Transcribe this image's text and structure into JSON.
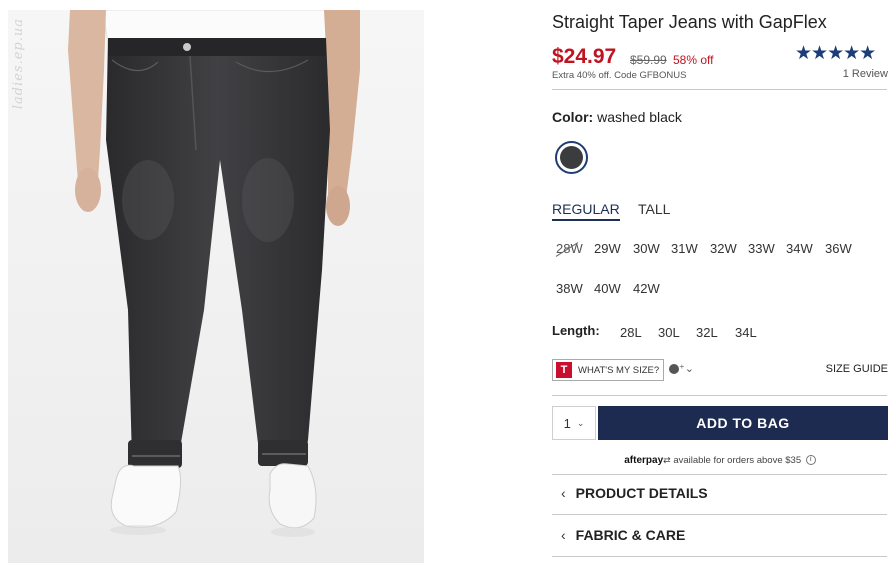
{
  "watermark": "ladies.ep.ua",
  "product": {
    "title": "Straight Taper Jeans with GapFlex",
    "price": "$24.97",
    "old_price": "$59.99",
    "discount": "58% off",
    "promo": "Extra 40% off. Code GFBONUS",
    "rating_stars": "★★★★★",
    "reviews": "1 Review"
  },
  "color": {
    "label": "Color:",
    "value": "washed black",
    "swatch_color": "#3b3c3e"
  },
  "fit_tabs": [
    "REGULAR",
    "TALL"
  ],
  "sizes_waist": [
    "28W",
    "29W",
    "30W",
    "31W",
    "32W",
    "33W",
    "34W",
    "36W",
    "38W",
    "40W",
    "42W"
  ],
  "length": {
    "label": "Length:",
    "options": [
      "28L",
      "30L",
      "32L",
      "34L"
    ]
  },
  "fit_tools": {
    "wims_badge": "T",
    "wims_label": "WHAT'S MY SIZE?",
    "user_dropdown": "⁺⌄",
    "size_guide": "SIZE GUIDE"
  },
  "cart": {
    "quantity": "1",
    "add_label": "ADD TO BAG"
  },
  "afterpay": {
    "logo": "afterpay",
    "text": "available for orders above $35",
    "info_icon": "i"
  },
  "accordions": [
    "PRODUCT DETAILS",
    "FABRIC & CARE"
  ],
  "colors": {
    "accent_navy": "#1c2b4f",
    "sale_red": "#c1121f"
  }
}
